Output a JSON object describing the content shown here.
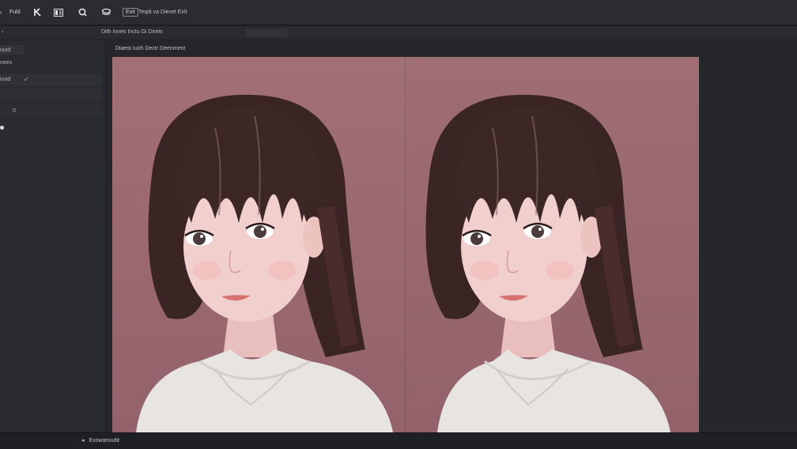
{
  "toolbar": {
    "file_label": "Fuld",
    "tool2_icon": "k-icon",
    "tool3_icon": "grid-icon",
    "tool4_icon": "zoom-icon",
    "tool5_icon": "layers-icon",
    "box_label": "Exit",
    "title": "Teqdi va Dievet Exit"
  },
  "subbar": {
    "left_glyph": "‹",
    "breadcrumb": "Dith Innes Inctu Gi Direts"
  },
  "sidebar": {
    "rows": [
      "ouid",
      "nees",
      "ioad"
    ],
    "check_glyph": "✓",
    "counter_value": "0"
  },
  "panel": {
    "title": "Diaest Iuoh Dectr Deenment"
  },
  "status": {
    "arrow": "◂",
    "text": "Exowaroudit"
  },
  "colors": {
    "background_wall": "#9b6a6e",
    "hair": "#3a2424",
    "skin": "#f0cfcc",
    "lace": "#e8e4e2"
  }
}
